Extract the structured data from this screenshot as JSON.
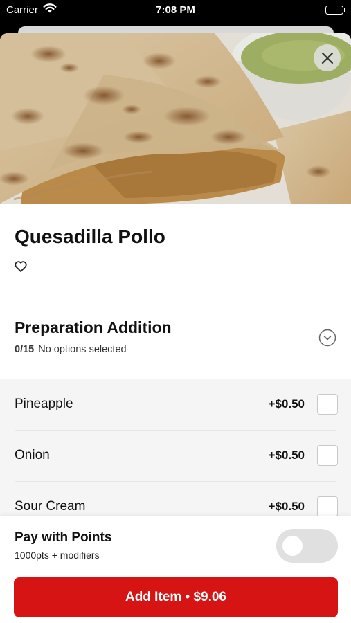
{
  "status_bar": {
    "carrier": "Carrier",
    "time": "7:08 PM"
  },
  "item": {
    "title": "Quesadilla Pollo",
    "image_alt": "quesadilla-photo"
  },
  "modifier_group": {
    "title": "Preparation Addition",
    "count": "0/15",
    "status": "No options selected",
    "options": [
      {
        "name": "Pineapple",
        "price": "+$0.50"
      },
      {
        "name": "Onion",
        "price": "+$0.50"
      },
      {
        "name": "Sour Cream",
        "price": "+$0.50"
      }
    ]
  },
  "points": {
    "title": "Pay with Points",
    "subtitle": "1000pts + modifiers",
    "enabled": false
  },
  "add_button": {
    "label": "Add Item • $9.06"
  },
  "colors": {
    "accent": "#d71414",
    "option_bg": "#f5f5f5",
    "toggle_off": "#e0e0e0"
  }
}
